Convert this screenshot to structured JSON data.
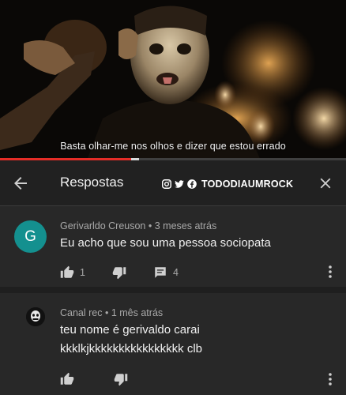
{
  "video": {
    "subtitle": "Basta olhar-me nos olhos e dizer que estou errado",
    "progress": 0.38,
    "handle_position": 0.38
  },
  "header": {
    "title": "Respostas",
    "watermark": "TODODIAUMROCK",
    "back_icon": "arrow-left-icon",
    "close_icon": "close-icon"
  },
  "comments": [
    {
      "avatar_letter": "G",
      "avatar_color": "#14908f",
      "author": "Gerivarldo Creuson",
      "time": "3 meses atrás",
      "text": "Eu acho que sou uma pessoa sociopata",
      "likes": "1",
      "replies": "4"
    },
    {
      "author": "Canal rec",
      "time": "1 mês atrás",
      "text_line1": "teu nome é gerivaldo carai",
      "text_line2": "kkklkjkkkkkkkkkkkkkkkk clb"
    }
  ],
  "colors": {
    "accent": "#e52d27",
    "background": "#282828",
    "header_bg": "#212121"
  }
}
